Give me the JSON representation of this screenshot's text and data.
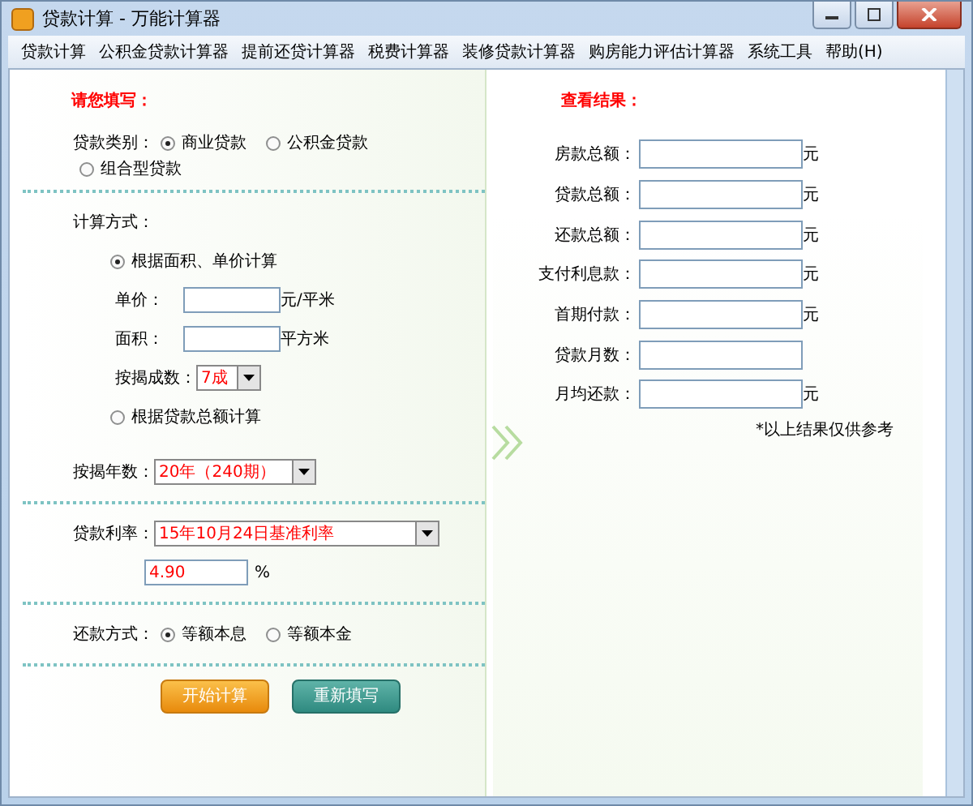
{
  "window": {
    "title": "贷款计算 - 万能计算器"
  },
  "menu": [
    "贷款计算",
    "公积金贷款计算器",
    "提前还贷计算器",
    "税费计算器",
    "装修贷款计算器",
    "购房能力评估计算器",
    "系统工具",
    "帮助(H)"
  ],
  "input": {
    "heading": "请您填写：",
    "loan_type": {
      "label": "贷款类别：",
      "options": [
        {
          "label": "商业贷款",
          "selected": true
        },
        {
          "label": "公积金贷款",
          "selected": false
        },
        {
          "label": "组合型贷款",
          "selected": false
        }
      ]
    },
    "calc_method": {
      "label": "计算方式：",
      "options": [
        {
          "label": "根据面积、单价计算",
          "selected": true
        },
        {
          "label": "根据贷款总额计算",
          "selected": false
        }
      ]
    },
    "unit_price": {
      "label": "单价：",
      "unit": "元/平米"
    },
    "area": {
      "label": "面积：",
      "unit": "平方米"
    },
    "down_ratio": {
      "label": "按揭成数：",
      "value": "7成"
    },
    "years": {
      "label": "按揭年数：",
      "value": "20年（240期）"
    },
    "rate": {
      "label": "贷款利率：",
      "value": "15年10月24日基准利率",
      "rate": "4.90",
      "unit": "%"
    },
    "repay": {
      "label": "还款方式：",
      "options": [
        {
          "label": "等额本息",
          "selected": true
        },
        {
          "label": "等额本金",
          "selected": false
        }
      ]
    },
    "buttons": [
      {
        "label": "开始计算",
        "kind": "primary"
      },
      {
        "label": "重新填写",
        "kind": "secondary"
      }
    ]
  },
  "results": {
    "heading": "查看结果：",
    "fields": [
      {
        "label": "房款总额：",
        "unit": "元"
      },
      {
        "label": "贷款总额：",
        "unit": "元"
      },
      {
        "label": "还款总额：",
        "unit": "元"
      },
      {
        "label": "支付利息款：",
        "unit": "元"
      },
      {
        "label": "首期付款：",
        "unit": "元"
      },
      {
        "label": "贷款月数："
      },
      {
        "label": "月均还款：",
        "unit": "元"
      }
    ],
    "note": "*以上结果仅供参考"
  }
}
